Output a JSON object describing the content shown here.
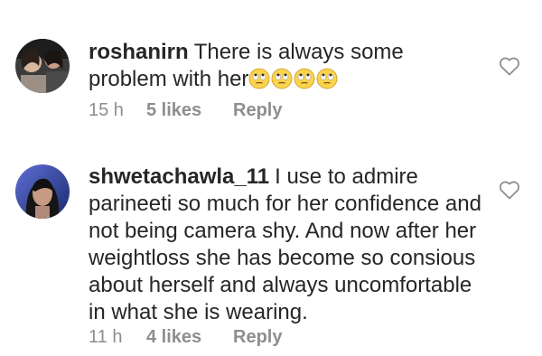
{
  "comments": [
    {
      "username": "roshanirn",
      "text": "There is always some problem with her",
      "emojis": [
        "face-with-rolling-eyes",
        "face-with-rolling-eyes",
        "face-with-rolling-eyes",
        "face-with-rolling-eyes"
      ],
      "time": "15 h",
      "likes": "5 likes",
      "reply": "Reply"
    },
    {
      "username": "shwetachawla_11",
      "text": "I use to admire parineeti so much for her confidence and not being camera shy. And now after her weightloss she has become so consious about herself and always uncomfortable in what she is wearing.",
      "time": "11 h",
      "likes": "4 likes",
      "reply": "Reply"
    }
  ],
  "colors": {
    "text": "#262626",
    "meta": "#8e8e8e",
    "emoji_fill": "#fcd34d"
  }
}
